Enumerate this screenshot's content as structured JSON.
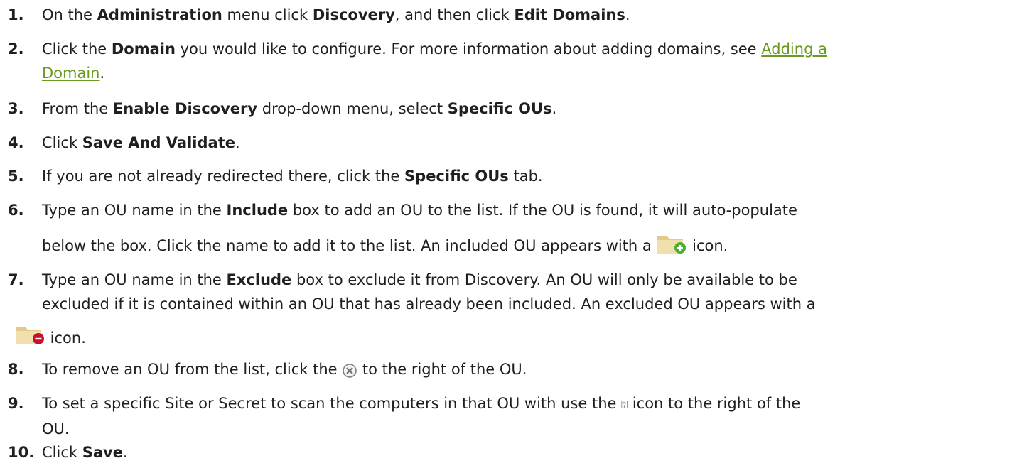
{
  "steps": [
    {
      "num": "1.",
      "t0": "On the ",
      "b1": "Administration",
      "t1": " menu click ",
      "b2": "Discovery",
      "t2": ", and then click ",
      "b3": "Edit Domains",
      "t3": "."
    },
    {
      "num": "2.",
      "t0": "Click the ",
      "b1": "Domain",
      "t1": " you would like to configure. For more information about adding domains, see ",
      "link_a": "Adding a",
      "link_b": "Domain",
      "t2": "."
    },
    {
      "num": "3.",
      "t0": "From the ",
      "b1": "Enable Discovery",
      "t1": " drop-down menu, select ",
      "b2": "Specific OUs",
      "t2": "."
    },
    {
      "num": "4.",
      "t0": "Click ",
      "b1": "Save And Validate",
      "t1": "."
    },
    {
      "num": "5.",
      "t0": "If you are not already redirected there, click the ",
      "b1": "Specific OUs",
      "t1": " tab."
    },
    {
      "num": "6.",
      "t0": "Type an OU name in the ",
      "b1": "Include",
      "t1": " box to add an OU to the list. If the OU is found, it will auto-populate",
      "t2": "below the box. Click the name to add it to the list. An included OU appears with a ",
      "t3": " icon."
    },
    {
      "num": "7.",
      "t0": "Type an OU name in the ",
      "b1": "Exclude",
      "t1": " box to exclude it from Discovery. An OU will only be available to be",
      "t2": "excluded if it is contained within an OU that has already been included. An excluded OU appears with a",
      "t3": " icon."
    },
    {
      "num": "8.",
      "t0": "To remove an OU from the list, click the ",
      "t1": " to the right of the OU."
    },
    {
      "num": "9.",
      "t0": "To set a specific Site or Secret to scan the computers in that OU with use the ",
      "glyph": "⍰",
      "t1": " icon to the right of the",
      "t2": "OU."
    },
    {
      "num": "10.",
      "t0": "Click ",
      "b1": "Save",
      "t1": "."
    }
  ],
  "colors": {
    "link": "#6a9a1f",
    "text": "#1f1f1f",
    "folder": "#e8d08a",
    "add_badge": "#4caf32",
    "remove_badge": "#c8102e"
  },
  "icons": [
    "folder-add-icon",
    "folder-remove-icon",
    "remove-circle-icon",
    "settings-placeholder-icon"
  ]
}
